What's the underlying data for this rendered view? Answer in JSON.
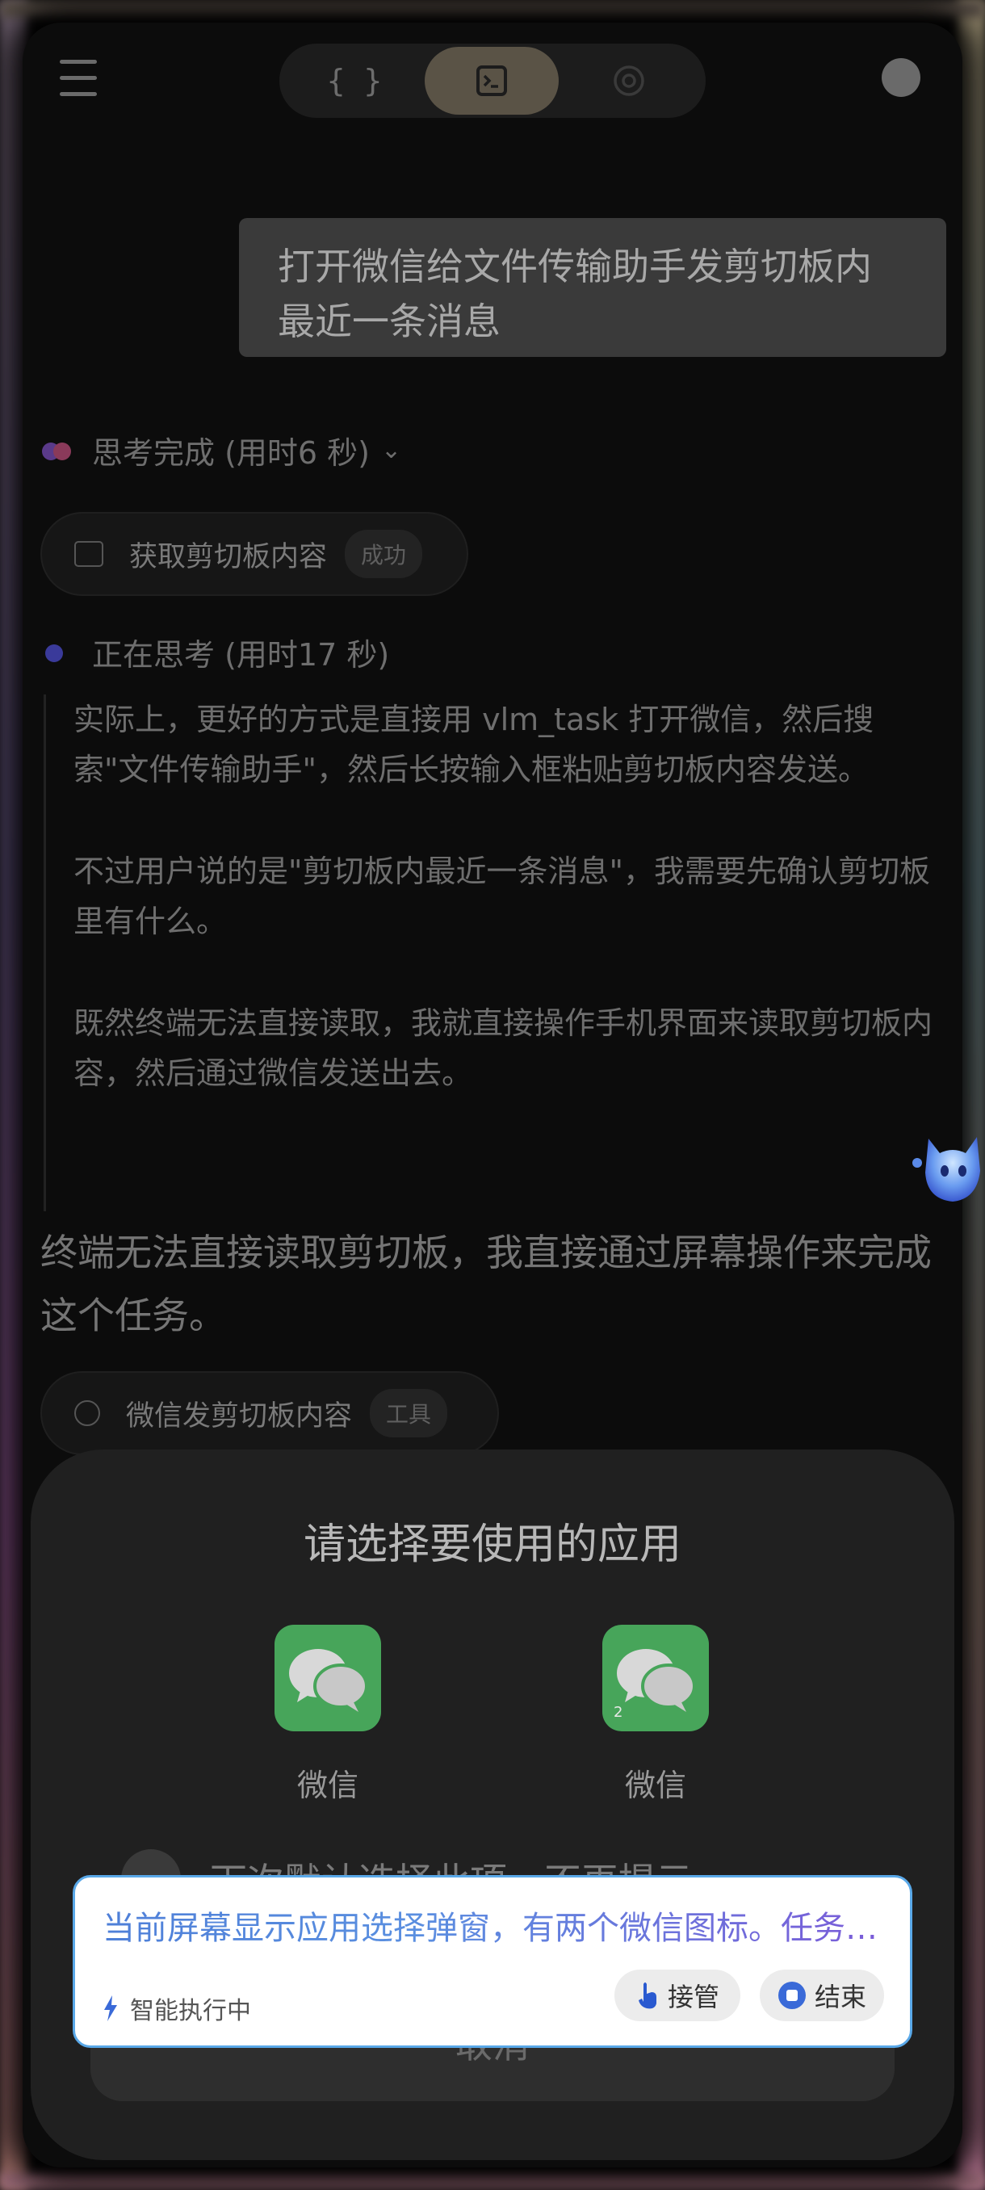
{
  "topbar": {
    "mode_buttons": [
      "{ }",
      "⌨",
      "◎"
    ]
  },
  "conversation": {
    "user_message": "打开微信给文件传输助手发剪切板内最近一条消息",
    "think_done": "思考完成 (用时6 秒)",
    "tool_chip_1": {
      "label": "获取剪切板内容",
      "tag": "成功"
    },
    "thinking": "正在思考 (用时17 秒)",
    "thought_paragraphs": [
      "实际上，更好的方式是直接用 vlm_task 打开微信，然后搜索\"文件传输助手\"，然后长按输入框粘贴剪切板内容发送。",
      "不过用户说的是\"剪切板内最近一条消息\"，我需要先确认剪切板里有什么。",
      "既然终端无法直接读取，我就直接操作手机界面来读取剪切板内容，然后通过微信发送出去。"
    ],
    "answer": "终端无法直接读取剪切板，我直接通过屏幕操作来完成这个任务。",
    "tool_chip_2": {
      "label": "微信发剪切板内容",
      "tag": "工具"
    }
  },
  "app_chooser": {
    "title": "请选择要使用的应用",
    "apps": [
      {
        "label": "微信",
        "badge": ""
      },
      {
        "label": "微信",
        "badge": "2"
      }
    ],
    "remember_label": "下次默认选择此项，不再提示",
    "cancel_label": "取消"
  },
  "status_card": {
    "message": "当前屏幕显示应用选择弹窗，有两个微信图标。任务需要打开微信给文件传输助手发送消息",
    "state": "智能执行中",
    "takeover_label": "接管",
    "end_label": "结束"
  },
  "colors": {
    "accent_blue": "#4e7fd8",
    "wechat_green": "#47a55a",
    "card_border": "#59a8e8"
  }
}
